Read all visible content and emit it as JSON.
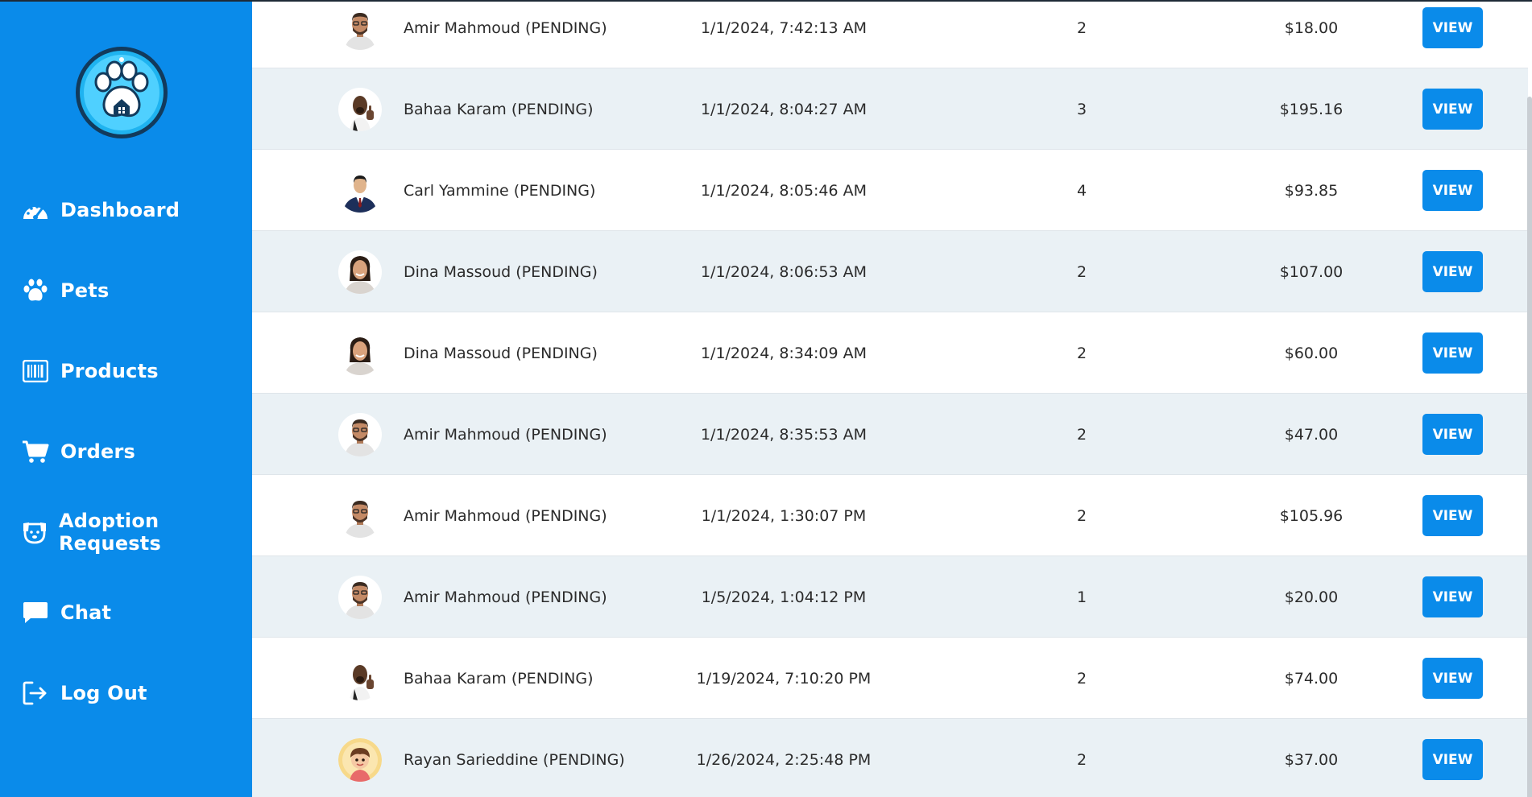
{
  "sidebar": {
    "nav": [
      {
        "label": "Dashboard",
        "icon": "dashboard-gauge-icon"
      },
      {
        "label": "Pets",
        "icon": "paw-icon"
      },
      {
        "label": "Products",
        "icon": "barcode-icon"
      },
      {
        "label": "Orders",
        "icon": "cart-icon"
      },
      {
        "label": "Adoption Requests",
        "icon": "dog-face-icon"
      },
      {
        "label": "Chat",
        "icon": "chat-bubble-icon"
      },
      {
        "label": "Log Out",
        "icon": "logout-icon"
      }
    ]
  },
  "orders": {
    "view_label": "VIEW",
    "rows": [
      {
        "customer": "Amir Mahmoud (PENDING)",
        "date": "1/1/2024, 7:42:13 AM",
        "items": "2",
        "total": "$18.00",
        "avatar": "amir"
      },
      {
        "customer": "Bahaa Karam (PENDING)",
        "date": "1/1/2024, 8:04:27 AM",
        "items": "3",
        "total": "$195.16",
        "avatar": "bahaa"
      },
      {
        "customer": "Carl Yammine (PENDING)",
        "date": "1/1/2024, 8:05:46 AM",
        "items": "4",
        "total": "$93.85",
        "avatar": "carl"
      },
      {
        "customer": "Dina Massoud (PENDING)",
        "date": "1/1/2024, 8:06:53 AM",
        "items": "2",
        "total": "$107.00",
        "avatar": "dina"
      },
      {
        "customer": "Dina Massoud (PENDING)",
        "date": "1/1/2024, 8:34:09 AM",
        "items": "2",
        "total": "$60.00",
        "avatar": "dina"
      },
      {
        "customer": "Amir Mahmoud (PENDING)",
        "date": "1/1/2024, 8:35:53 AM",
        "items": "2",
        "total": "$47.00",
        "avatar": "amir"
      },
      {
        "customer": "Amir Mahmoud (PENDING)",
        "date": "1/1/2024, 1:30:07 PM",
        "items": "2",
        "total": "$105.96",
        "avatar": "amir"
      },
      {
        "customer": "Amir Mahmoud (PENDING)",
        "date": "1/5/2024, 1:04:12 PM",
        "items": "1",
        "total": "$20.00",
        "avatar": "amir"
      },
      {
        "customer": "Bahaa Karam (PENDING)",
        "date": "1/19/2024, 7:10:20 PM",
        "items": "2",
        "total": "$74.00",
        "avatar": "bahaa"
      },
      {
        "customer": "Rayan Sarieddine (PENDING)",
        "date": "1/26/2024, 2:25:48 PM",
        "items": "2",
        "total": "$37.00",
        "avatar": "rayan"
      }
    ]
  }
}
